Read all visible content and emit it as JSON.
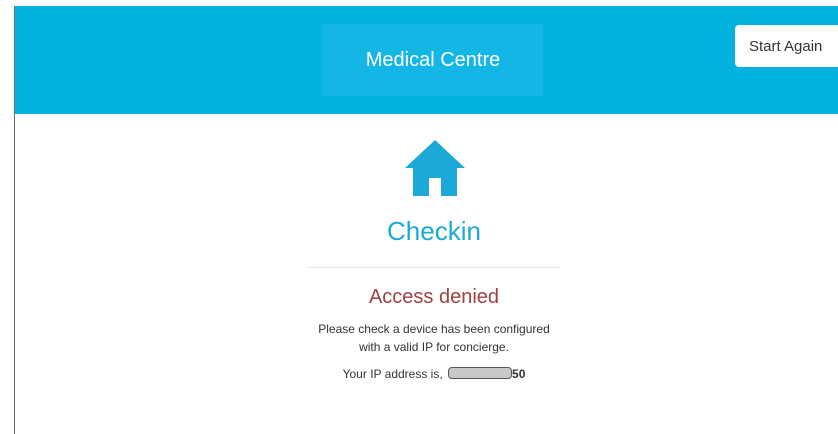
{
  "header": {
    "title": "Medical Centre",
    "start_again_label": "Start Again",
    "color": "#03b2df"
  },
  "icons": {
    "home": "home-icon"
  },
  "main": {
    "heading": "Checkin",
    "error_title": "Access denied",
    "message_line1": "Please check a device has been configured",
    "message_line2": "with a valid IP for concierge.",
    "ip_prefix": "Your IP address is,",
    "ip_suffix": "50"
  }
}
